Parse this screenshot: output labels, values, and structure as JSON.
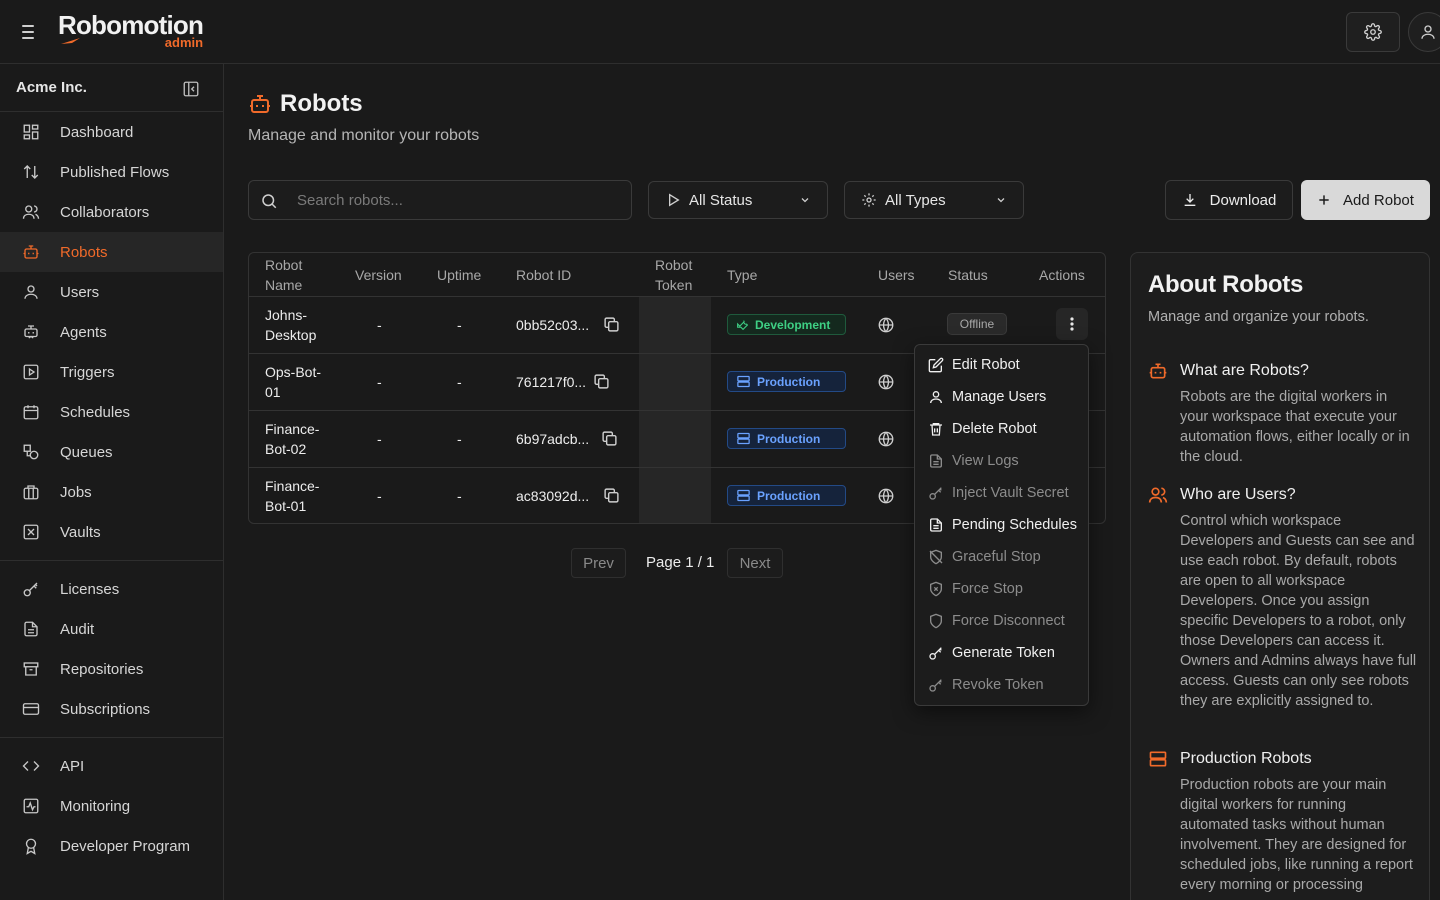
{
  "brand": {
    "name": "Robomotion",
    "sub": "admin",
    "accent": "#f06a2a"
  },
  "org": {
    "name": "Acme Inc."
  },
  "sidebar": {
    "items": [
      {
        "label": "Dashboard",
        "icon": "dashboard-icon"
      },
      {
        "label": "Published Flows",
        "icon": "arrows-up-down-icon"
      },
      {
        "label": "Collaborators",
        "icon": "users-icon"
      },
      {
        "label": "Robots",
        "icon": "robot-icon",
        "active": true
      },
      {
        "label": "Users",
        "icon": "user-icon"
      },
      {
        "label": "Agents",
        "icon": "agent-icon"
      },
      {
        "label": "Triggers",
        "icon": "play-square-icon"
      },
      {
        "label": "Schedules",
        "icon": "calendar-icon"
      },
      {
        "label": "Queues",
        "icon": "shapes-icon"
      },
      {
        "label": "Jobs",
        "icon": "briefcase-icon"
      },
      {
        "label": "Vaults",
        "icon": "vault-icon"
      }
    ],
    "items2": [
      {
        "label": "Licenses",
        "icon": "key-icon"
      },
      {
        "label": "Audit",
        "icon": "document-icon"
      },
      {
        "label": "Repositories",
        "icon": "archive-icon"
      },
      {
        "label": "Subscriptions",
        "icon": "credit-card-icon"
      }
    ],
    "items3": [
      {
        "label": "API",
        "icon": "code-icon"
      },
      {
        "label": "Monitoring",
        "icon": "activity-icon"
      },
      {
        "label": "Developer Program",
        "icon": "award-icon"
      }
    ]
  },
  "page": {
    "title": "Robots",
    "subtitle": "Manage and monitor your robots"
  },
  "toolbar": {
    "search_placeholder": "Search robots...",
    "status_filter": "All Status",
    "type_filter": "All Types",
    "download_label": "Download",
    "add_label": "Add Robot"
  },
  "table": {
    "headers": {
      "name": "Robot Name",
      "version": "Version",
      "uptime": "Uptime",
      "robot_id": "Robot ID",
      "token": "Robot Token",
      "type": "Type",
      "users": "Users",
      "status": "Status",
      "actions": "Actions"
    },
    "rows": [
      {
        "name": "Johns-Desktop",
        "version": "-",
        "uptime": "-",
        "robot_id": "0bb52c03...",
        "type": "Development",
        "status": "Offline"
      },
      {
        "name": "Ops-Bot-01",
        "version": "-",
        "uptime": "-",
        "robot_id": "761217f0...",
        "type": "Production",
        "status": ""
      },
      {
        "name": "Finance-Bot-02",
        "version": "-",
        "uptime": "-",
        "robot_id": "6b97adcb...",
        "type": "Production",
        "status": ""
      },
      {
        "name": "Finance-Bot-01",
        "version": "-",
        "uptime": "-",
        "robot_id": "ac83092d...",
        "type": "Production",
        "status": ""
      }
    ],
    "type_colors": {
      "Development": "#3ecf84",
      "Production": "#6aa2ff"
    }
  },
  "pagination": {
    "prev": "Prev",
    "page_text": "Page 1 / 1",
    "next": "Next"
  },
  "actions_menu": [
    {
      "label": "Edit Robot",
      "icon": "edit-icon",
      "enabled": true
    },
    {
      "label": "Manage Users",
      "icon": "user-icon",
      "enabled": true
    },
    {
      "label": "Delete Robot",
      "icon": "trash-icon",
      "enabled": true
    },
    {
      "label": "View Logs",
      "icon": "document-icon",
      "enabled": false
    },
    {
      "label": "Inject Vault Secret",
      "icon": "key-icon",
      "enabled": false
    },
    {
      "label": "Pending Schedules",
      "icon": "document-icon",
      "enabled": true
    },
    {
      "label": "Graceful Stop",
      "icon": "shield-off-icon",
      "enabled": false
    },
    {
      "label": "Force Stop",
      "icon": "shield-x-icon",
      "enabled": false
    },
    {
      "label": "Force Disconnect",
      "icon": "shield-icon",
      "enabled": false
    },
    {
      "label": "Generate Token",
      "icon": "key-icon",
      "enabled": true
    },
    {
      "label": "Revoke Token",
      "icon": "key-icon",
      "enabled": false
    }
  ],
  "about": {
    "title": "About Robots",
    "subtitle": "Manage and organize your robots.",
    "sections": [
      {
        "title": "What are Robots?",
        "icon": "robot-icon",
        "body": "Robots are the digital workers in your workspace that execute your automation flows, either locally or in the cloud."
      },
      {
        "title": "Who are Users?",
        "icon": "users-icon",
        "body": "Control which workspace Developers and Guests can see and use each robot. By default, robots are open to all workspace Developers. Once you assign specific Developers to a robot, only those Developers can access it. Owners and Admins always have full access. Guests can only see robots they are explicitly assigned to."
      },
      {
        "title": "Production Robots",
        "icon": "server-icon",
        "body": "Production robots are your main digital workers for running automated tasks without human involvement. They are designed for scheduled jobs, like running a report every morning or processing"
      }
    ]
  }
}
